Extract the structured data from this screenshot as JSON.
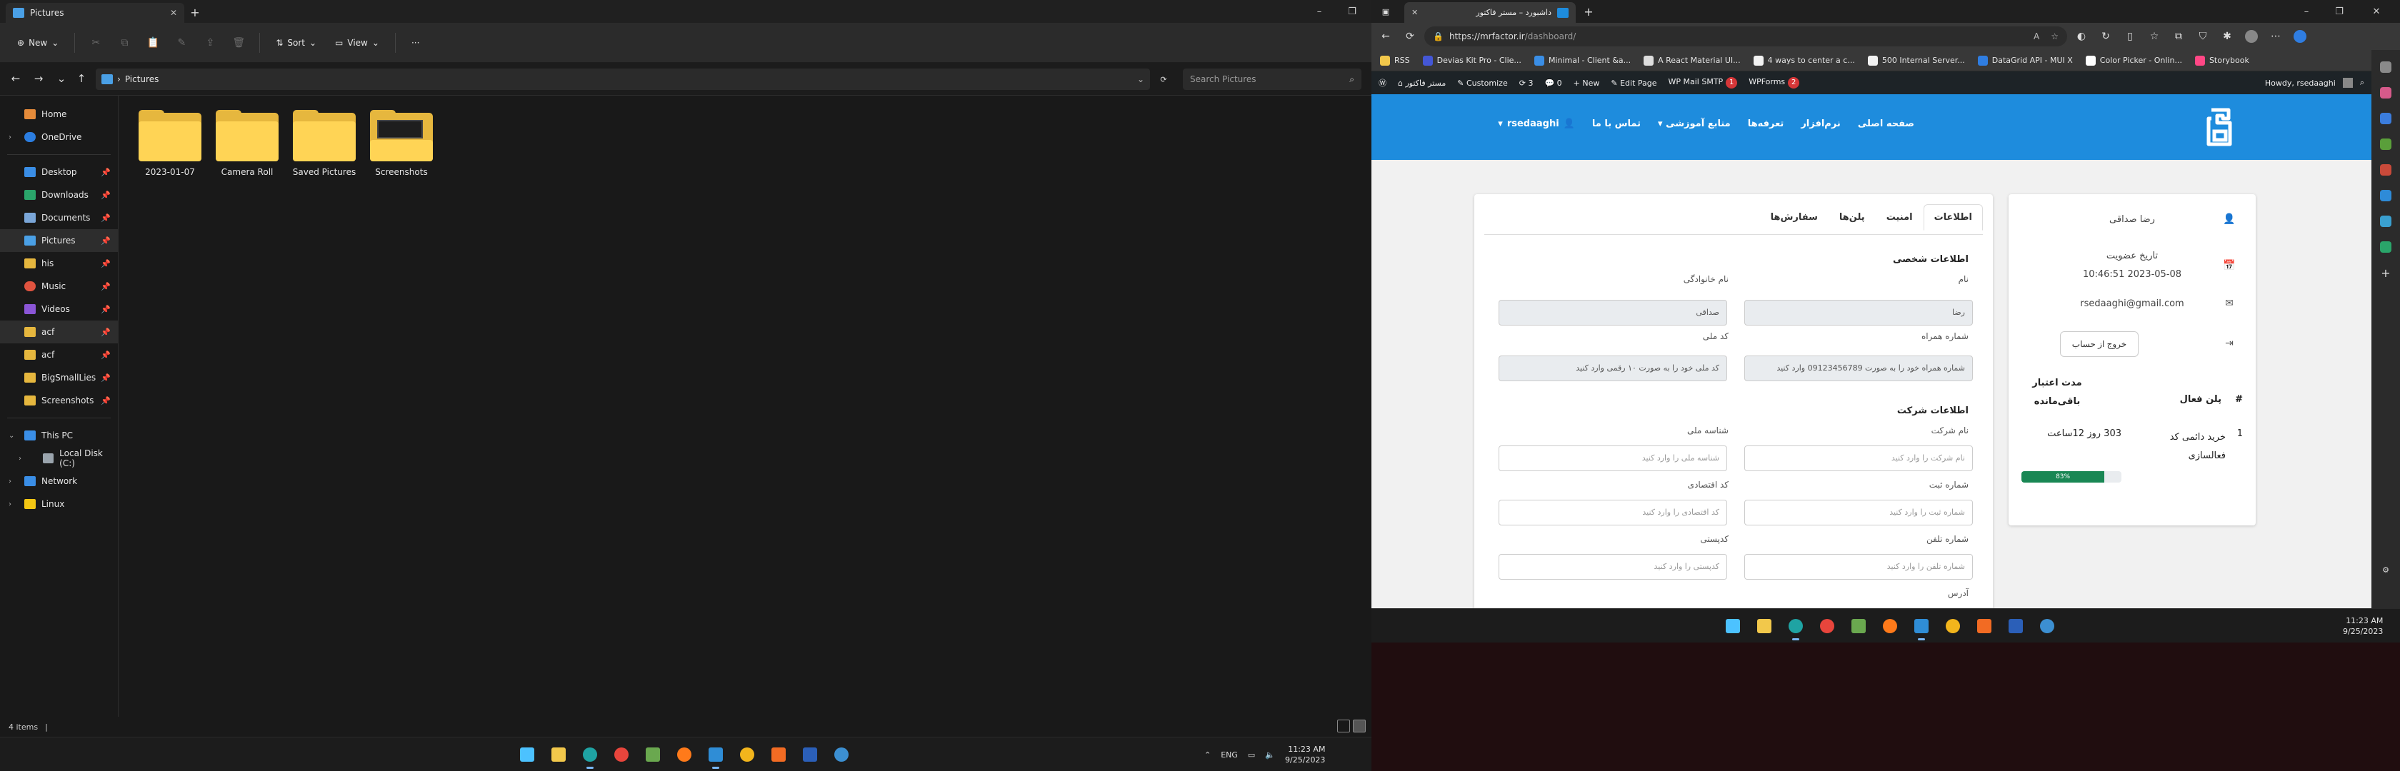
{
  "explorer": {
    "tab_title": "Pictures",
    "toolbar": {
      "new_label": "New",
      "sort_label": "Sort",
      "view_label": "View",
      "more_label": "···"
    },
    "address": {
      "path": "Pictures",
      "search_placeholder": "Search Pictures"
    },
    "nav": {
      "home": "Home",
      "onedrive": "OneDrive",
      "quick": [
        "Desktop",
        "Downloads",
        "Documents",
        "Pictures",
        "his",
        "Music",
        "Videos",
        "acf",
        "acf",
        "BigSmallLies",
        "Screenshots"
      ],
      "this_pc": "This PC",
      "local_disk": "Local Disk (C:)",
      "network": "Network",
      "linux": "Linux"
    },
    "folders": [
      {
        "name": "2023-01-07"
      },
      {
        "name": "Camera Roll"
      },
      {
        "name": "Saved Pictures"
      },
      {
        "name": "Screenshots"
      }
    ],
    "status": {
      "count": "4 items",
      "sep": "|"
    }
  },
  "taskbar_left": {
    "lang": "ENG",
    "time": "11:23 AM",
    "date": "9/25/2023"
  },
  "taskbar_right": {
    "time": "11:23 AM",
    "date": "9/25/2023"
  },
  "edge": {
    "tab_title": "داشبورد – مستر فاکتور",
    "url_host": "https://mrfactor.ir",
    "url_path": "/dashboard/",
    "bookmarks": [
      "RSS",
      "Devias Kit Pro - Clie...",
      "Minimal - Client &a...",
      "A React Material UI...",
      "4 ways to center a c...",
      "500 Internal Server...",
      "DataGrid API - MUI X",
      "Color Picker - Onlin...",
      "Storybook"
    ],
    "wp": {
      "site": "مستر فاکتور",
      "customize": "Customize",
      "updates": "3",
      "comments": "0",
      "new": "New",
      "edit": "Edit Page",
      "smtp": "WP Mail SMTP",
      "smtp_badge": "1",
      "wpforms": "WPForms",
      "wpforms_badge": "2",
      "howdy": "Howdy, rsedaaghi"
    }
  },
  "site": {
    "menu": [
      "صفحه اصلی",
      "نرم‌افزار",
      "تعرفه‌ها",
      "منابع آموزشی",
      "تماس با ما"
    ],
    "username": "rsedaaghi",
    "tabs": [
      "اطلاعات",
      "امنیت",
      "پلن‌ها",
      "سفارش‌ها"
    ],
    "personal": {
      "title": "اطلاعات شخصی",
      "first_label": "نام",
      "first_value": "رضا",
      "last_label": "نام خانوادگی",
      "last_value": "صداقی",
      "mobile_label": "شماره همراه",
      "mobile_placeholder": "شماره همراه خود را به صورت 09123456789 وارد کنید",
      "national_label": "کد ملی",
      "national_placeholder": "کد ملی خود را به صورت ۱۰ رقمی وارد کنید"
    },
    "company": {
      "title": "اطلاعات شرکت",
      "name_label": "نام شرکت",
      "name_placeholder": "نام شرکت را وارد کنید",
      "nid_label": "شناسه ملی",
      "nid_placeholder": "شناسه ملی را وارد کنید",
      "reg_label": "شماره ثبت",
      "reg_placeholder": "شماره ثبت را وارد کنید",
      "eco_label": "کد اقتصادی",
      "eco_placeholder": "کد اقتصادی را وارد کنید",
      "phone_label": "شماره تلفن",
      "phone_placeholder": "شماره تلفن را وارد کنید",
      "postal_label": "کدپستی",
      "postal_placeholder": "کدپستی را وارد کنید",
      "address_label": "آدرس"
    },
    "profile": {
      "name": "رضا صداقی",
      "member_since_label": "تاریخ عضویت",
      "member_since": "2023-05-08 10:46:51",
      "email": "rsedaaghi@gmail.com",
      "logout": "خروج از حساب"
    },
    "plan": {
      "col_num": "#",
      "col_plan": "پلن فعال",
      "col_remaining_1": "مدت اعتبار",
      "col_remaining_2": "باقی‌مانده",
      "row_num": "1",
      "row_plan": "خرید دائمی کد فعالسازی",
      "row_remaining": "303 روز 12ساعت",
      "progress": 83,
      "progress_label": "83%"
    }
  }
}
